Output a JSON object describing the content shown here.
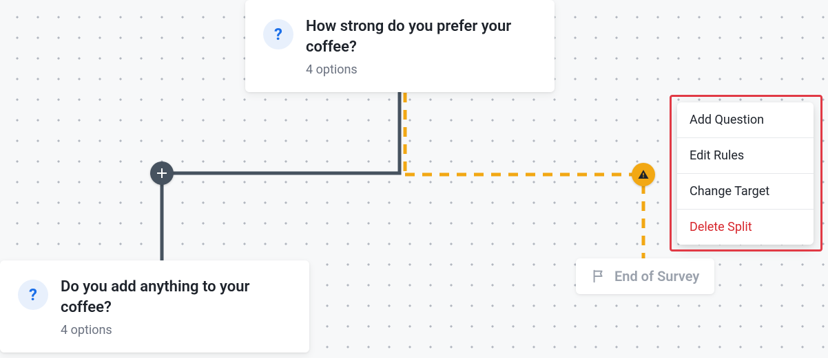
{
  "nodes": {
    "q1": {
      "title": "How strong do you prefer your coffee?",
      "meta": "4 options"
    },
    "q2": {
      "title": "Do you add anything to your coffee?",
      "meta": "4 options"
    },
    "end": {
      "label": "End of Survey"
    }
  },
  "menu": {
    "add_question": "Add Question",
    "edit_rules": "Edit Rules",
    "change_target": "Change Target",
    "delete_split": "Delete Split"
  },
  "icons": {
    "question": "?",
    "warning": "!"
  }
}
